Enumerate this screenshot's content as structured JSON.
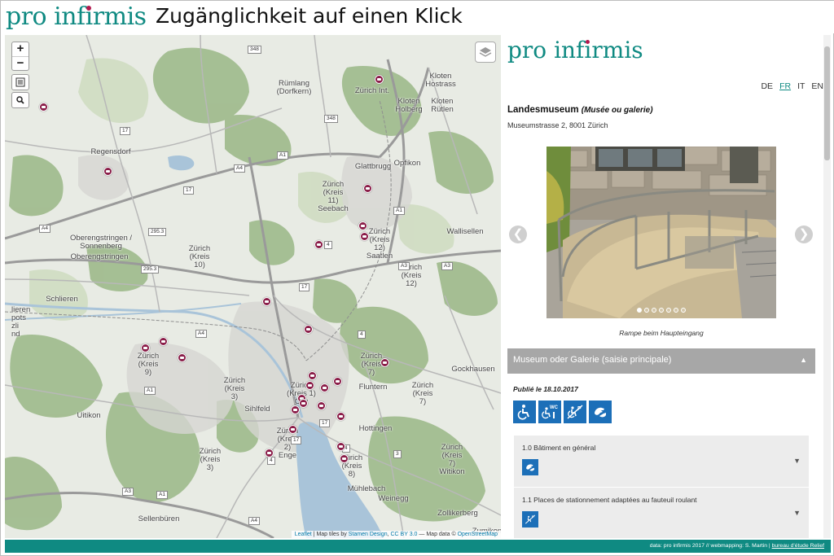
{
  "header": {
    "logo": {
      "part1": "pro inf",
      "dot_letter": "ı",
      "part2": "rmis"
    },
    "title": "Zugänglichkeit auf einen Klick"
  },
  "map": {
    "zoom_in": "+",
    "zoom_out": "−",
    "attribution": {
      "leaflet": "Leaflet",
      "tiles_prefix": " | Map tiles by ",
      "stamen": "Stamen Design",
      "sep": ", ",
      "license": "CC BY 3.0",
      "data_prefix": " — Map data © ",
      "osm": "OpenStreetMap"
    },
    "places": [
      "Rümlang\n(Dorfkern)",
      "Zürich Int.",
      "Kloten\nHostrass",
      "Kloten\nHolberg",
      "Kloten\nRütlen",
      "Regensdorf",
      "Glattbrugg",
      "Opfikon",
      "Zürich\n(Kreis\n11)\nSeebach",
      "Wallisellen",
      "Oberengstringen /\nSonnenberg",
      "Oberengstringen",
      "Zürich\n(Kreis\n10)",
      "Zürich\n(Kreis\n12)\nSaatlen",
      "Zürich\n(Kreis\n12)",
      "Schlieren",
      "Zürich\n(Kreis\n9)",
      "Zürich\n(Kreis\n3)",
      "Sihlfeld",
      "Zürich\n(Kreis 1)\nCity",
      "Zürich\n(Kreis\n7)",
      "Fluntern",
      "Hottingen",
      "Zürich\n(Kreis\n7)",
      "Gockhausen",
      "Uitikon",
      "Zürich\n(Kreis\n3)",
      "Zürich\n(Kreis\n2)\nEnge",
      "Zürich\n(Kreis\n8)",
      "Mühlebach",
      "Weinegg",
      "Zürich\n(Kreis\n7)\nWitikon",
      "Zollikerberg",
      "Sellenbüren",
      "Zumikon",
      "lieren\npots\nzli\nnd"
    ],
    "shields": [
      "348",
      "348",
      "17",
      "A1",
      "A4",
      "17",
      "4",
      "A4",
      "295.3",
      "295.3",
      "A1",
      "A3",
      "A3",
      "17",
      "4",
      "A1",
      "A4",
      "17",
      "17",
      "4",
      "A1",
      "A3",
      "A4",
      "3",
      "4"
    ]
  },
  "panel": {
    "logo": {
      "part1": "pro inf",
      "dot_letter": "ı",
      "part2": "rmis"
    },
    "languages": [
      "DE",
      "FR",
      "IT",
      "EN"
    ],
    "active_language": "FR",
    "place_name": "Landesmuseum",
    "place_type": "(Musée ou galerie)",
    "address": "Museumstrasse 2, 8001 Zürich",
    "photo_caption": "Rampe beim Haupteingang",
    "photo_count": 7,
    "photo_index": 1,
    "category": "Museum oder Galerie (saisie principale)",
    "published": "Publié le 18.10.2017",
    "badges": [
      "wheelchair-icon",
      "accessible-wc-icon",
      "accessible-parking-icon",
      "sign-language-icon"
    ],
    "sections": [
      {
        "title": "1.0 Bâtiment en général",
        "icon": "sign-language-icon"
      },
      {
        "title": "1.1 Places de stationnement adaptées au fauteuil roulant",
        "icon": "accessible-parking-icon"
      }
    ],
    "prev": "❮",
    "next": "❯",
    "expand_glyph": "▲",
    "collapse_glyph": "▼"
  },
  "footer": {
    "text": "data: pro infirmis 2017  //  webmapping: S. Martin | ",
    "link": "bureau d'étude Relief"
  },
  "colors": {
    "brand_teal": "#0f8a82",
    "marker": "#8a1d48",
    "badge_blue": "#1c6fb8",
    "category_bar": "#a7a7a7"
  }
}
